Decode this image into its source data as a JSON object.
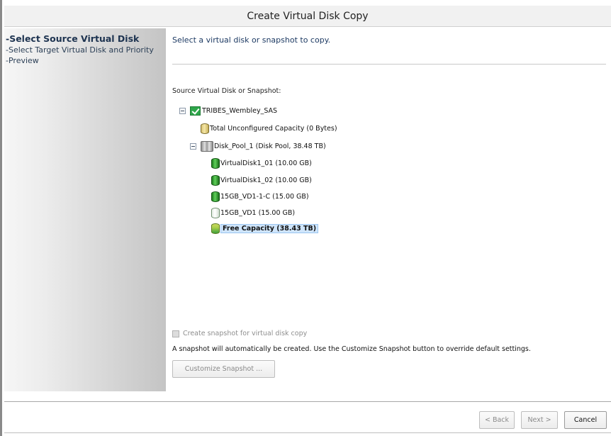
{
  "window": {
    "title": "Create Virtual Disk Copy"
  },
  "steps": [
    {
      "label": "-Select Source Virtual Disk",
      "active": true
    },
    {
      "label": "-Select Target Virtual Disk and Priority",
      "active": false
    },
    {
      "label": "-Preview",
      "active": false
    }
  ],
  "content": {
    "instruction": "Select a virtual disk or snapshot to copy.",
    "tree_label": "Source Virtual Disk or Snapshot:",
    "tree": {
      "root": {
        "label": "TRIBES_Wembley_SAS",
        "icon": "check-icon",
        "expanded": true
      },
      "unconfigured": {
        "label": "Total Unconfigured Capacity (0 Bytes)",
        "icon": "cylinder-yellow-icon"
      },
      "pool": {
        "label": "Disk_Pool_1 (Disk Pool, 38.48 TB)",
        "icon": "disk-pool-icon",
        "expanded": true
      },
      "disks": [
        {
          "label": "VirtualDisk1_01 (10.00 GB)",
          "icon": "virtual-disk-green-icon"
        },
        {
          "label": "VirtualDisk1_02 (10.00 GB)",
          "icon": "virtual-disk-green-icon"
        },
        {
          "label": "15GB_VD1-1-C (15.00 GB)",
          "icon": "virtual-disk-green-icon"
        },
        {
          "label": "15GB_VD1 (15.00 GB)",
          "icon": "virtual-disk-outline-icon"
        }
      ],
      "free": {
        "label": "Free Capacity (38.43 TB)",
        "icon": "free-capacity-icon",
        "selected": true
      }
    },
    "snapshot_checkbox": {
      "label": "Create snapshot for virtual disk copy",
      "checked": false,
      "enabled": false
    },
    "snapshot_note": "A snapshot will automatically be created. Use the Customize Snapshot button to override default settings.",
    "customize_button": "Customize Snapshot ..."
  },
  "footer": {
    "back": "< Back",
    "next": "Next >",
    "cancel": "Cancel"
  },
  "colors": {
    "step_text": "#2b3f56",
    "instruction_text": "#1d3a63",
    "selection_bg": "#cfe5fb",
    "disk_green": "#3cb043"
  }
}
